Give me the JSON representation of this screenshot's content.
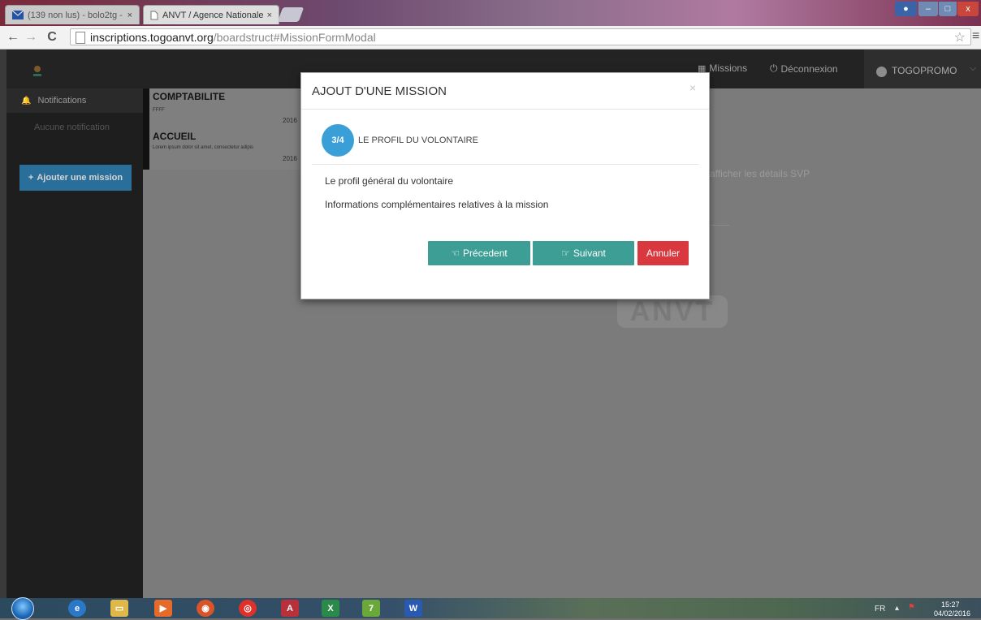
{
  "browser": {
    "tabs": [
      {
        "label": "(139 non lus) - bolo2tg - ",
        "active": false
      },
      {
        "label": "ANVT / Agence Nationale",
        "active": true
      }
    ],
    "tab_close": "×",
    "url_host": "inscriptions.togoanvt.org",
    "url_path": "/boardstruct#MissionFormModal",
    "window_controls": {
      "minimize": "–",
      "maximize": "□",
      "close": "x"
    }
  },
  "nav": {
    "missions_label": "Missions",
    "logout_label": "Déconnexion",
    "user_name": "TOGOPROMO",
    "user_initial": "t"
  },
  "sidebar": {
    "notifications_label": "Notifications",
    "empty_label": "Aucune notification",
    "add_mission_label": "Ajouter une mission"
  },
  "background": {
    "cards": [
      {
        "title": "COMPTABILITE",
        "subtitle": "FFFF",
        "date": "2016"
      },
      {
        "title": "ACCUEIL",
        "subtitle": "Lorem ipsum dolor sit amet, consectetur adipis",
        "date": "2016"
      }
    ],
    "details_hint": "afficher les détails SVP",
    "watermark": "ANVT"
  },
  "modal": {
    "title": "AJOUT D'UNE MISSION",
    "close": "×",
    "step": "3/4",
    "step_label": "LE PROFIL DU VOLONTAIRE",
    "lines": [
      "Le profil général du volontaire",
      "Informations complémentaires relatives à la mission"
    ],
    "prev_label": "Précedent",
    "next_label": "Suivant",
    "cancel_label": "Annuler"
  },
  "taskbar": {
    "language": "FR",
    "time": "15:27",
    "date": "04/02/2016"
  },
  "colors": {
    "step_blue": "#3a9fd6",
    "teal": "#3d9e95",
    "danger": "#d9383e",
    "add_button": "#2a6f9a"
  }
}
